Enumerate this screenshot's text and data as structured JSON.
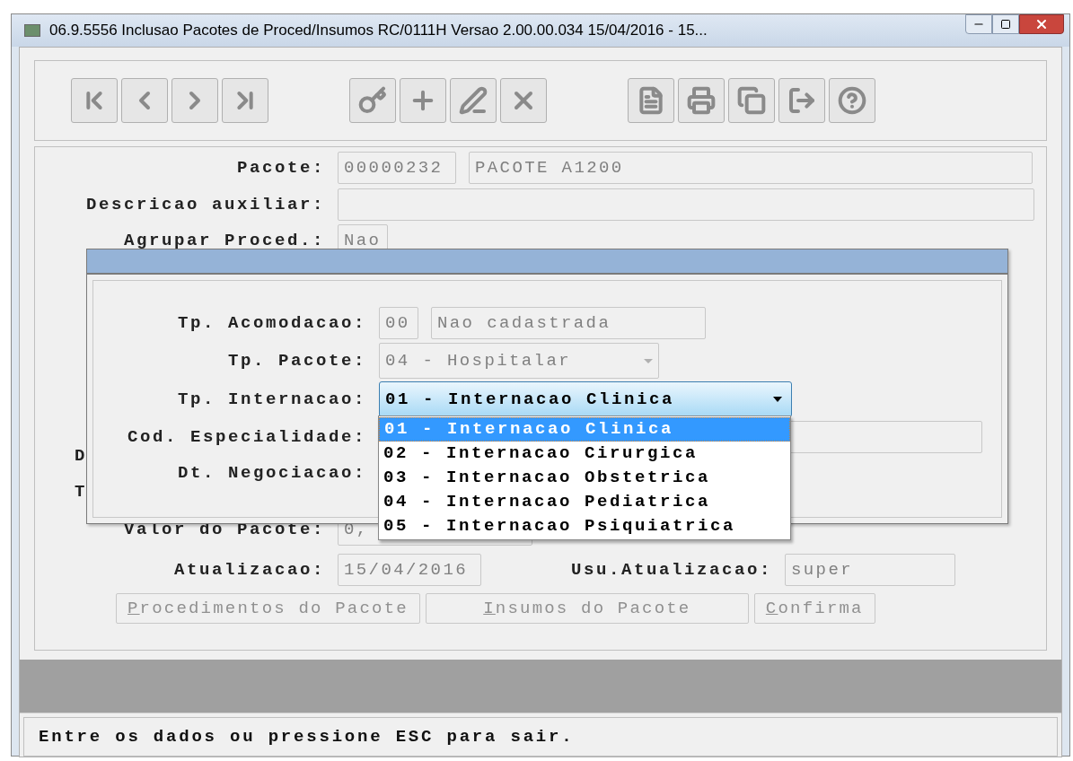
{
  "window": {
    "title": "06.9.5556  Inclusao  Pacotes de Proced/Insumos RC/0111H Versao 2.00.00.034 15/04/2016 - 15..."
  },
  "form": {
    "pacote": {
      "label": "Pacote:",
      "code": "00000232",
      "name": "PACOTE A1200"
    },
    "descricao": {
      "label": "Descricao auxiliar:"
    },
    "agrupar": {
      "label": "Agrupar Proced.:",
      "value": "Nao"
    },
    "covered_labels": [
      "D",
      "T"
    ],
    "valor": {
      "label": "Valor do Pacote:",
      "value": "0,"
    },
    "atualizacao": {
      "label": "Atualizacao:",
      "value": "15/04/2016"
    },
    "usuario": {
      "label": "Usu.Atualizacao:",
      "value": "super"
    }
  },
  "buttons": [
    {
      "label": "Procedimentos do Pacote",
      "disabled": true
    },
    {
      "label": "Insumos do Pacote",
      "disabled": true
    },
    {
      "label": "Confirma",
      "disabled": true
    }
  ],
  "dialog": {
    "acomodacao": {
      "label": "Tp. Acomodacao:",
      "code": "00",
      "name": "Nao cadastrada"
    },
    "tipo_pacote": {
      "label": "Tp. Pacote:",
      "value": "04 - Hospitalar"
    },
    "internacao": {
      "label": "Tp. Internacao:",
      "value": "01 - Internacao Clinica",
      "expanded": true,
      "options": [
        {
          "label": "01 - Internacao Clinica",
          "selected": true
        },
        {
          "label": "02 - Internacao Cirurgica",
          "selected": false
        },
        {
          "label": "03 - Internacao Obstetrica",
          "selected": false
        },
        {
          "label": "04 - Internacao Pediatrica",
          "selected": false
        },
        {
          "label": "05 - Internacao Psiquiatrica",
          "selected": false
        }
      ]
    },
    "especialidade": {
      "label": "Cod. Especialidade:"
    },
    "negociacao": {
      "label": "Dt. Negociacao:"
    }
  },
  "status_bar": "Entre os dados ou pressione ESC para sair."
}
